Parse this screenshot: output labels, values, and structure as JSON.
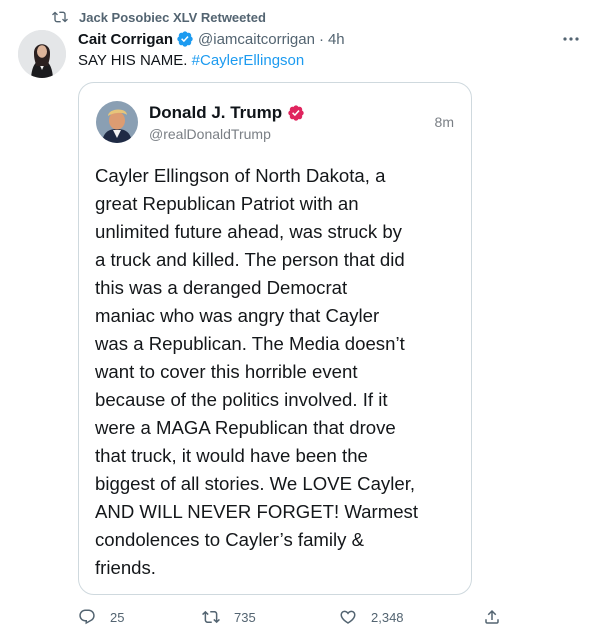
{
  "social_context": {
    "text": "Jack Posobiec XLV Retweeted"
  },
  "tweet": {
    "author_name": "Cait Corrigan",
    "author_handle": "@iamcaitcorrigan",
    "separator": "·",
    "time": "4h",
    "text": "SAY HIS NAME.",
    "hashtag": "#CaylerEllingson"
  },
  "embedded_tweet": {
    "author_name": "Donald J. Trump",
    "author_handle": "@realDonaldTrump",
    "time": "8m",
    "body_lines": [
      "Cayler Ellingson of North Dakota, a",
      "great Republican Patriot with an",
      "unlimited future ahead, was struck by",
      "a truck and killed. The person that did",
      "this was a deranged Democrat",
      "maniac who was angry that Cayler",
      "was a Republican. The Media doesn’t",
      "want to cover this horrible event",
      "because of the politics involved. If it",
      "were a MAGA Republican that drove",
      "that truck, it would have been the",
      "biggest of all stories. We LOVE Cayler,",
      "AND WILL NEVER FORGET! Warmest",
      "condolences to Cayler’s family &",
      "friends."
    ]
  },
  "actions": {
    "reply_count": "25",
    "retweet_count": "735",
    "like_count": "2,348"
  },
  "icons": {
    "retweet": "retweet-icon",
    "verified": "verified-badge-icon",
    "more": "more-options-icon",
    "reply": "reply-icon",
    "like": "heart-icon",
    "share": "share-icon"
  },
  "colors": {
    "accent": "#1d9bf0",
    "secondary_text": "#536471",
    "verified_pink": "#e0245e"
  }
}
